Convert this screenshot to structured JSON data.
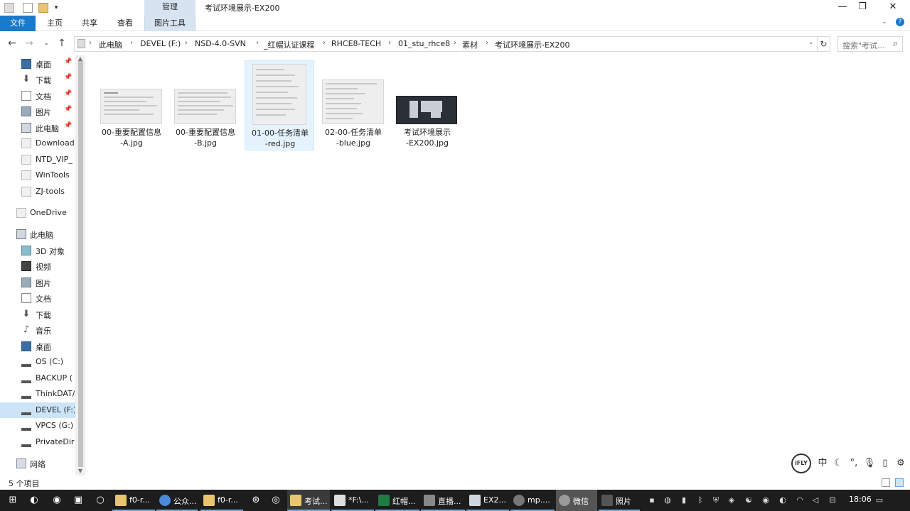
{
  "window": {
    "title": "考试环境展示-EX200",
    "context_tab_group": "管理",
    "controls": {
      "minimize": "—",
      "restore": "❐",
      "close": "✕"
    }
  },
  "ribbon": {
    "tabs": [
      {
        "label": "文件",
        "active": true
      },
      {
        "label": "主页"
      },
      {
        "label": "共享"
      },
      {
        "label": "查看"
      },
      {
        "label": "图片工具"
      }
    ]
  },
  "address": {
    "breadcrumbs": [
      "此电脑",
      "DEVEL (F:)",
      "NSD-4.0-SVN",
      "_红帽认证课程",
      "RHCE8-TECH",
      "01_stu_rhce8",
      "素材",
      "考试环境展示-EX200"
    ],
    "search_placeholder": "搜索\"考试...",
    "icons": {
      "back": "back-arrow-icon",
      "forward": "forward-arrow-icon",
      "up": "up-arrow-icon",
      "refresh": "refresh-icon",
      "search": "search-icon"
    }
  },
  "nav_pane": {
    "quick_access": [
      {
        "label": "桌面",
        "icon": "desktop-icon",
        "pinned": true
      },
      {
        "label": "下载",
        "icon": "download-icon",
        "pinned": true
      },
      {
        "label": "文档",
        "icon": "document-icon",
        "pinned": true
      },
      {
        "label": "图片",
        "icon": "picture-icon",
        "pinned": true
      },
      {
        "label": "此电脑",
        "icon": "computer-icon",
        "pinned": true
      },
      {
        "label": "Download",
        "icon": "folder-icon"
      },
      {
        "label": "NTD_VIP_",
        "icon": "folder-icon"
      },
      {
        "label": "WinTools",
        "icon": "folder-icon"
      },
      {
        "label": "ZJ-tools",
        "icon": "folder-icon"
      }
    ],
    "onedrive": {
      "label": "OneDrive",
      "icon": "onedrive-icon"
    },
    "this_pc": {
      "label": "此电脑",
      "icon": "computer-icon",
      "children": [
        {
          "label": "3D 对象",
          "icon": "3d-objects-icon"
        },
        {
          "label": "视频",
          "icon": "video-icon"
        },
        {
          "label": "图片",
          "icon": "picture-icon"
        },
        {
          "label": "文档",
          "icon": "document-icon"
        },
        {
          "label": "下载",
          "icon": "download-icon"
        },
        {
          "label": "音乐",
          "icon": "music-icon"
        },
        {
          "label": "桌面",
          "icon": "desktop-icon"
        },
        {
          "label": "OS (C:)",
          "icon": "windows-drive-icon"
        },
        {
          "label": "BACKUP (",
          "icon": "drive-icon"
        },
        {
          "label": "ThinkDAT/",
          "icon": "drive-icon"
        },
        {
          "label": "DEVEL (F:)",
          "icon": "drive-icon",
          "selected": true
        },
        {
          "label": "VPCS (G:)",
          "icon": "drive-icon"
        },
        {
          "label": "PrivateDir",
          "icon": "drive-icon"
        }
      ]
    },
    "network": {
      "label": "网络",
      "icon": "network-icon"
    }
  },
  "files": [
    {
      "name_line1": "00-重要配置信息",
      "name_line2": "-A.jpg",
      "thumb": "wide"
    },
    {
      "name_line1": "00-重要配置信息",
      "name_line2": "-B.jpg",
      "thumb": "wide"
    },
    {
      "name_line1": "01-00-任务清单",
      "name_line2": "-red.jpg",
      "thumb": "tall",
      "selected": true
    },
    {
      "name_line1": "02-00-任务清单",
      "name_line2": "-blue.jpg",
      "thumb": "mid"
    },
    {
      "name_line1": "考试环境展示",
      "name_line2": "-EX200.jpg",
      "thumb": "dark"
    }
  ],
  "status": {
    "item_count": "5 个项目"
  },
  "ime_toolbar": {
    "logo": "iFLY",
    "buttons": [
      {
        "label": "中",
        "icon": "chinese-mode-icon"
      },
      {
        "label": "☾",
        "icon": "half-width-icon"
      },
      {
        "label": "°,",
        "icon": "punctuation-icon"
      },
      {
        "label": "🎙",
        "icon": "microphone-icon"
      },
      {
        "label": "▯",
        "icon": "keyboard-icon"
      },
      {
        "label": "⚙",
        "icon": "settings-icon"
      }
    ]
  },
  "taskbar": {
    "apps": [
      {
        "label": "f0-r...",
        "icon": "explorer-icon"
      },
      {
        "label": "公众...",
        "icon": "chrome-icon"
      },
      {
        "label": "f0-r...",
        "icon": "explorer-icon"
      },
      {
        "label": "考试...",
        "icon": "explorer-icon",
        "active": true
      },
      {
        "label": "*F:\\...",
        "icon": "notepad-icon"
      },
      {
        "label": "红帽...",
        "icon": "excel-icon"
      },
      {
        "label": "直播...",
        "icon": "app-icon"
      },
      {
        "label": "EX2...",
        "icon": "image-viewer-icon"
      },
      {
        "label": "mp....",
        "icon": "media-icon"
      },
      {
        "label": "微信",
        "icon": "wechat-icon",
        "highlight": true
      },
      {
        "label": "照片",
        "icon": "photos-icon"
      }
    ],
    "clock": "18:06",
    "accent_color": "#7aa9d6"
  }
}
